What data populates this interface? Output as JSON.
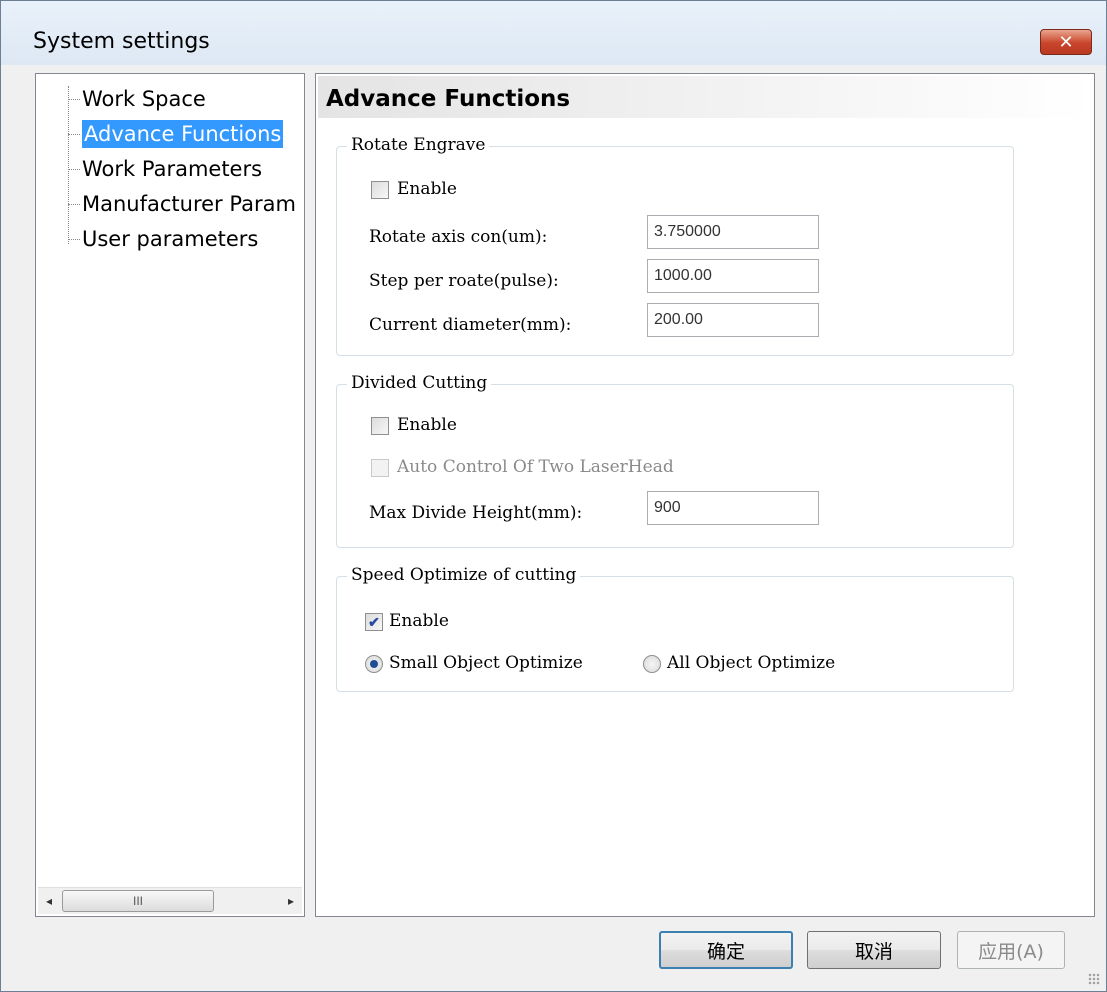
{
  "window": {
    "title": "System settings",
    "close_icon": "close-icon",
    "close_glyph": "✕",
    "accent_close": "#c9442a"
  },
  "tree": {
    "items": [
      {
        "label": "Work Space"
      },
      {
        "label": "Advance Functions",
        "selected": true
      },
      {
        "label": "Work Parameters"
      },
      {
        "label": "Manufacturer Param"
      },
      {
        "label": "User parameters"
      }
    ],
    "scroll": {
      "left_glyph": "◂",
      "right_glyph": "▸",
      "thumb_glyph": "III"
    }
  },
  "panel": {
    "title": "Advance Functions",
    "rotate": {
      "group_label": "Rotate Engrave",
      "enable_label": "Enable",
      "enable_checked": false,
      "axis_label": "Rotate axis con(um):",
      "axis_value": "3.750000",
      "step_label": "Step per roate(pulse):",
      "step_value": "1000.00",
      "diameter_label": "Current diameter(mm):",
      "diameter_value": "200.00"
    },
    "divided": {
      "group_label": "Divided Cutting",
      "enable_label": "Enable",
      "enable_checked": false,
      "auto_label": "Auto Control Of Two LaserHead",
      "auto_checked": false,
      "height_label": "Max Divide Height(mm):",
      "height_value": "900"
    },
    "speed": {
      "group_label": "Speed Optimize of cutting",
      "enable_label": "Enable",
      "enable_checked": true,
      "check_glyph": "✔",
      "small_label": "Small Object Optimize",
      "all_label": "All Object Optimize",
      "selected": "small"
    }
  },
  "buttons": {
    "ok": "确定",
    "cancel": "取消",
    "apply": "应用(A)"
  }
}
